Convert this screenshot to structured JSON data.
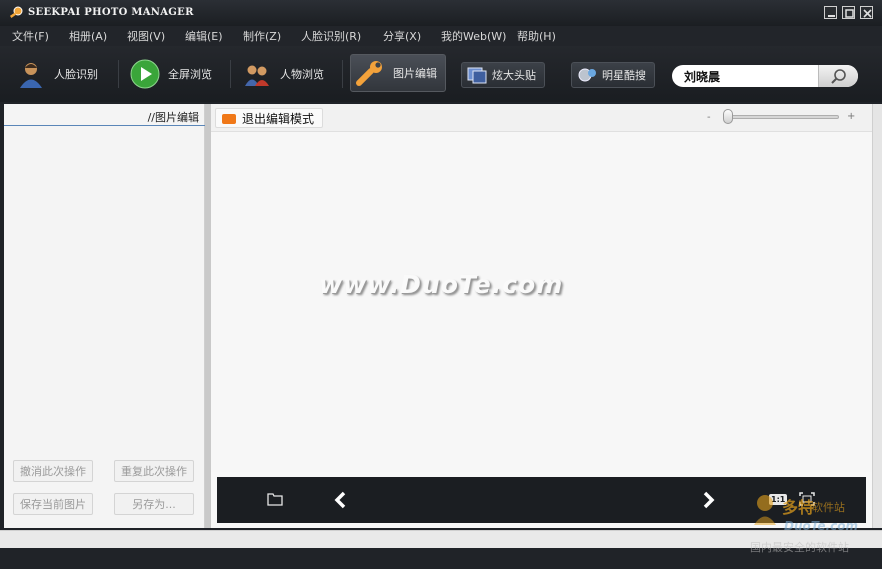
{
  "window": {
    "title": "SEEKPAI PHOTO MANAGER",
    "title_accent": "#e8a23a"
  },
  "menu": [
    {
      "label": "文件(F)"
    },
    {
      "label": "相册(A)"
    },
    {
      "label": "视图(V)"
    },
    {
      "label": "编辑(E)"
    },
    {
      "label": "制作(Z)"
    },
    {
      "label": "人脸识别(R)"
    },
    {
      "label": "分享(X)"
    },
    {
      "label": "我的Web(W)"
    },
    {
      "label": "帮助(H)"
    }
  ],
  "toolbar": {
    "face_recognition": "人脸识别",
    "fullscreen_browse": "全屏浏览",
    "people_browse": "人物浏览",
    "photo_edit": "图片编辑",
    "cool_avatar": "炫大头贴",
    "star_search": "明星酷搜",
    "search_value": "刘晓晨",
    "active_tool": "photo_edit"
  },
  "left_panel": {
    "header": "//图片编辑",
    "undo": "撤消此次操作",
    "redo": "重复此次操作",
    "save_current": "保存当前图片",
    "save_as": "另存为..."
  },
  "editor": {
    "exit_edit_mode": "退出编辑模式",
    "zoom_minus": "-",
    "zoom_plus": "+",
    "zoom_level": 0.02,
    "watermark": "www.DuoTe.com"
  },
  "bottom_bar": {
    "actual_size": "1:1"
  },
  "corner_watermark": {
    "brand": "多特",
    "brand_sub": "软件站",
    "domain": "DuoTe.com",
    "tagline": "国内最安全的软件站"
  },
  "colors": {
    "accent_orange": "#f07818",
    "panel_divider_blue": "#5a86b8"
  }
}
